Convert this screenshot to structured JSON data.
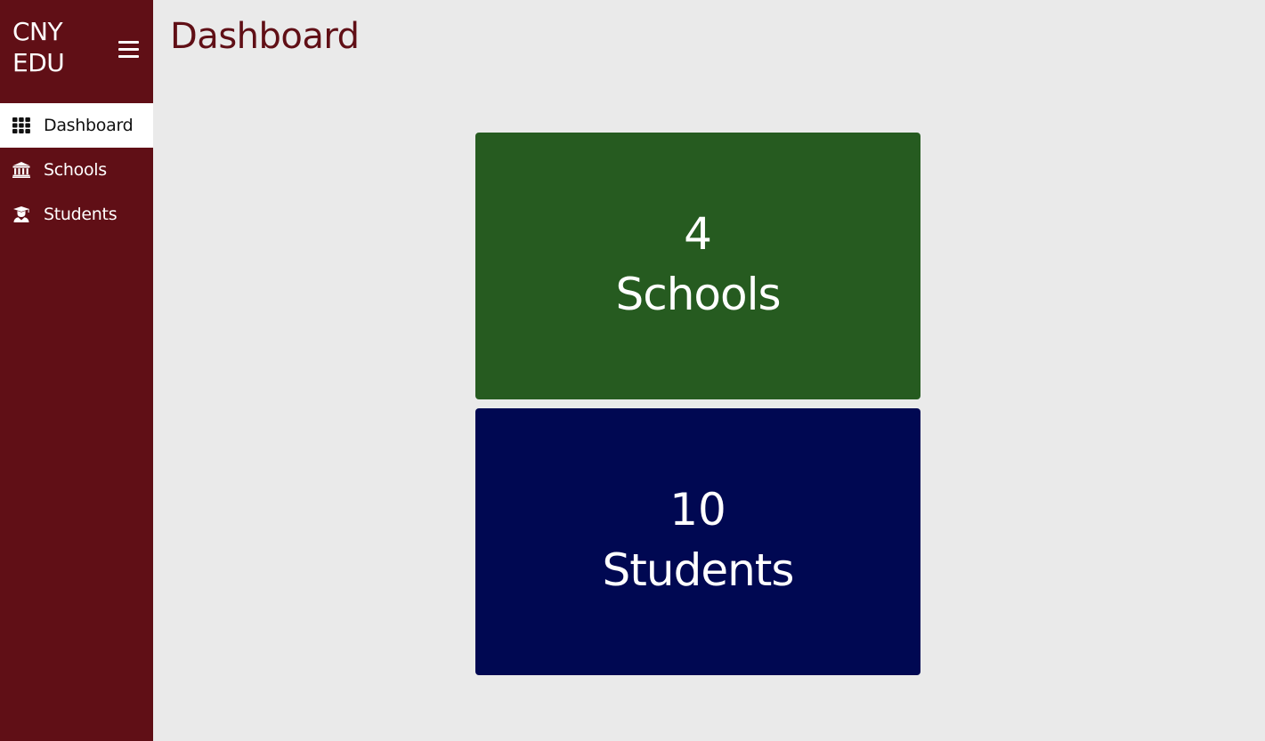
{
  "brand": {
    "title": "CNY EDU"
  },
  "sidebar": {
    "items": [
      {
        "label": "Dashboard",
        "icon": "grid-icon",
        "active": true
      },
      {
        "label": "Schools",
        "icon": "institution-icon",
        "active": false
      },
      {
        "label": "Students",
        "icon": "graduate-icon",
        "active": false
      }
    ]
  },
  "header": {
    "title": "Dashboard"
  },
  "cards": [
    {
      "count": "4",
      "label": "Schools",
      "color": "#265b20"
    },
    {
      "count": "10",
      "label": "Students",
      "color": "#000852"
    }
  ],
  "theme": {
    "sidebar_bg": "#600f16",
    "page_bg": "#eaeaea",
    "title_color": "#600f16"
  }
}
